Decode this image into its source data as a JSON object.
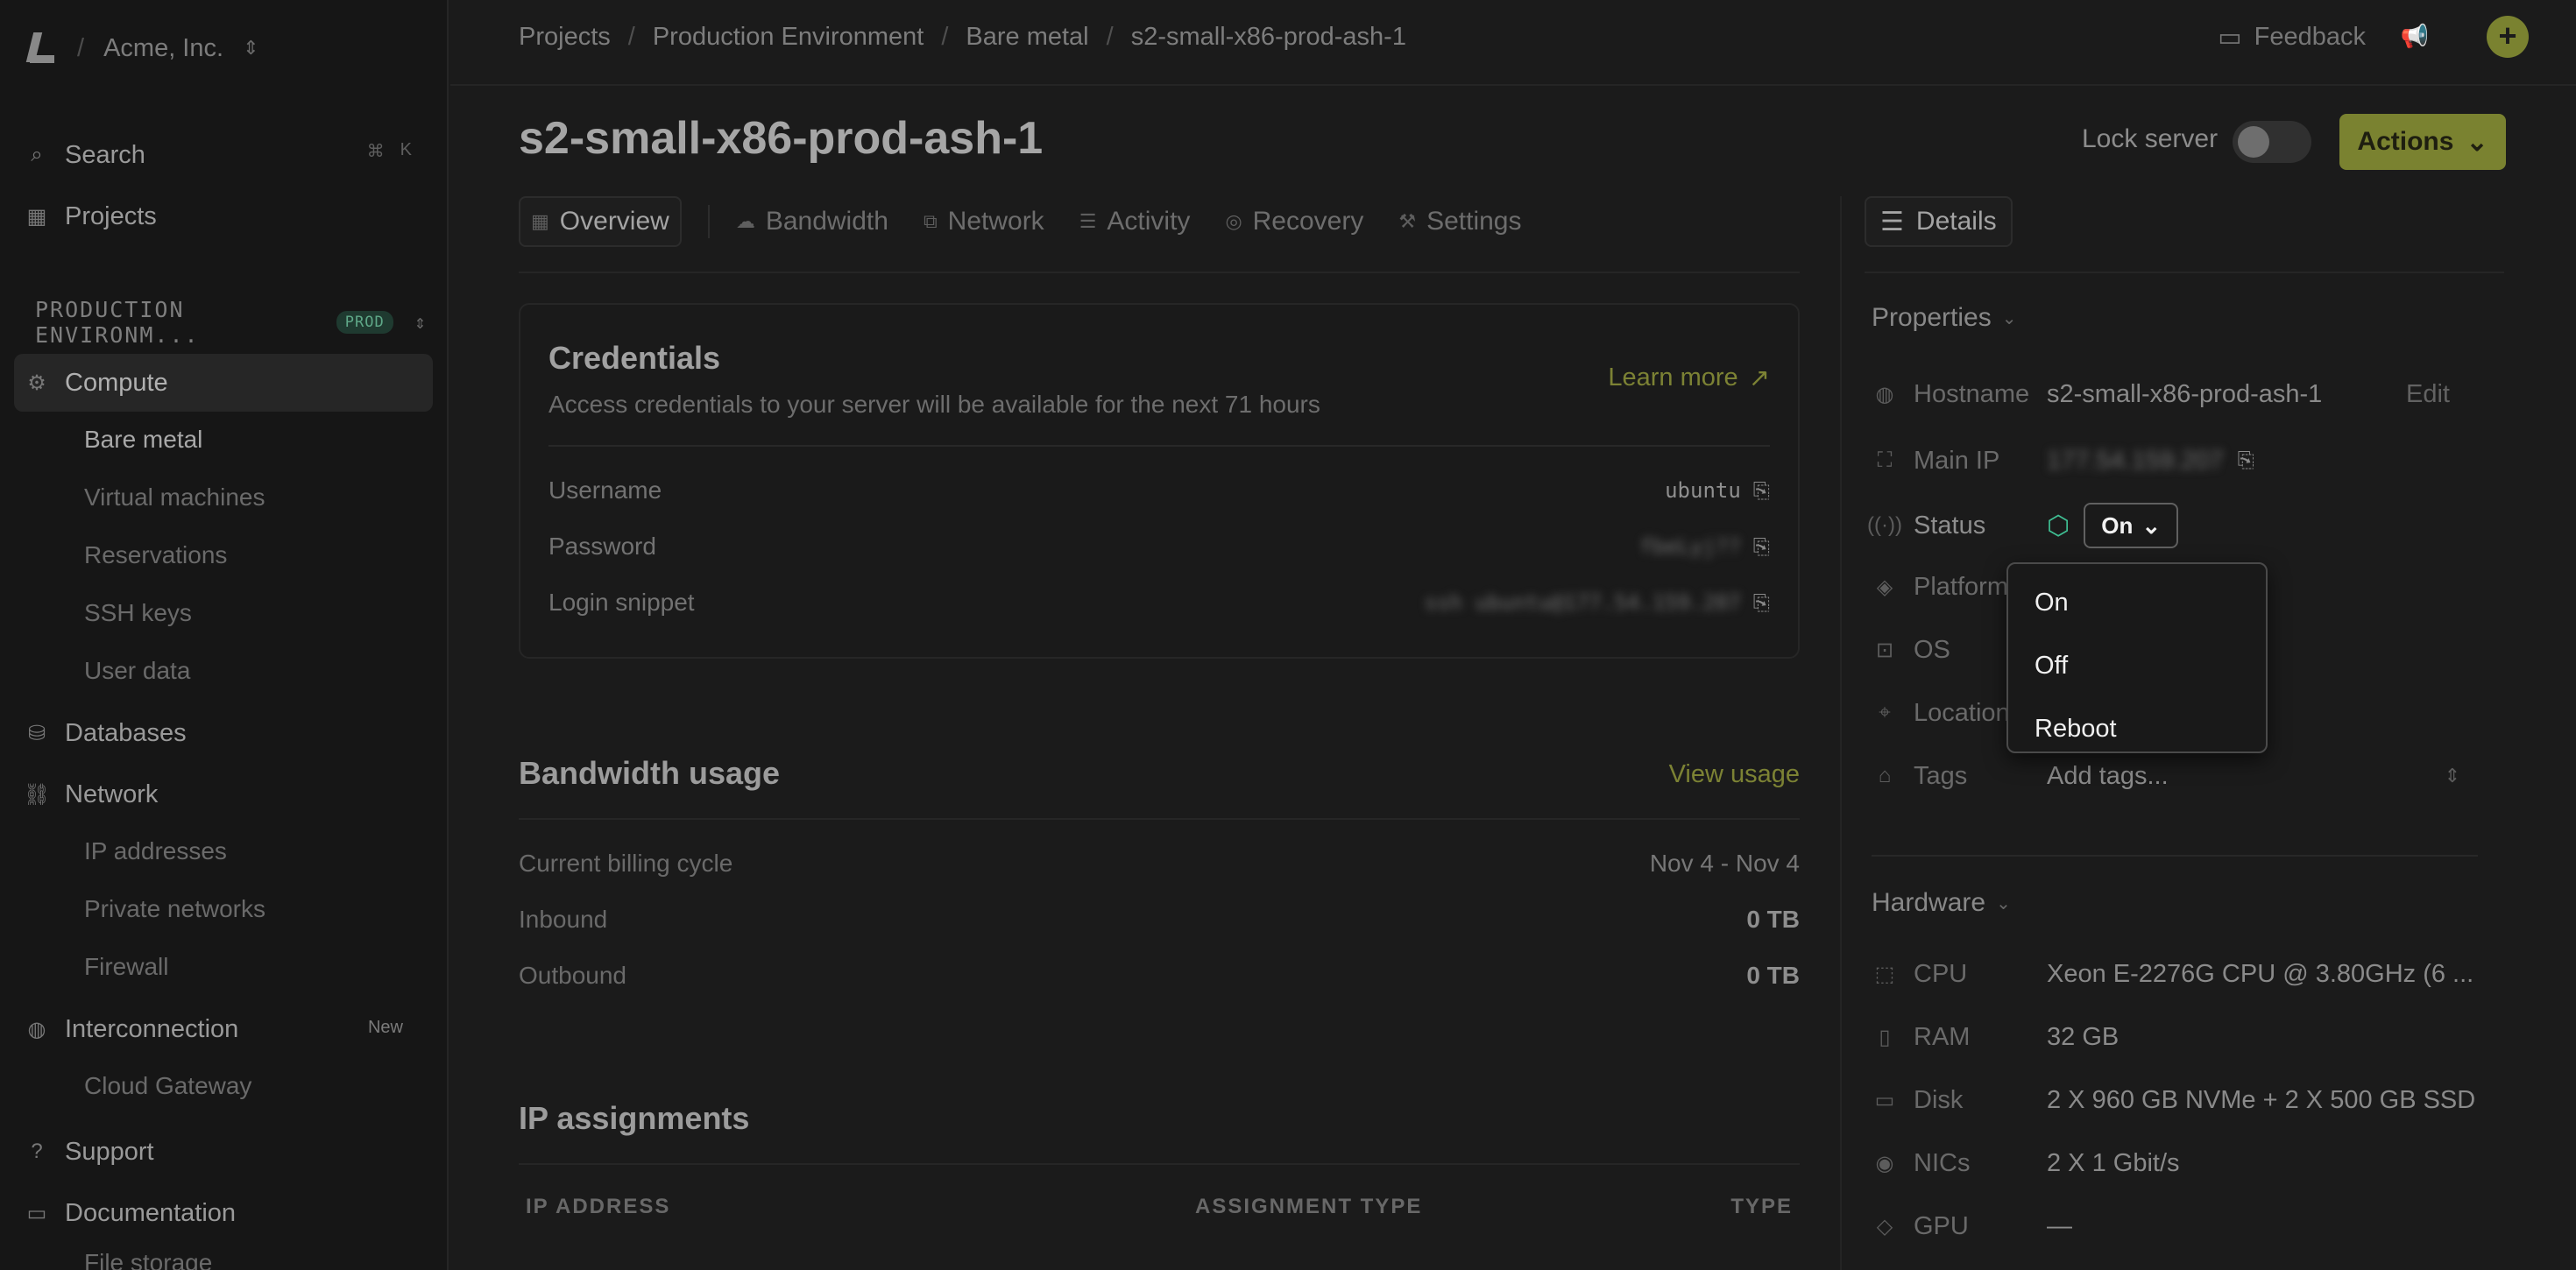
{
  "org": {
    "name": "Acme, Inc."
  },
  "sidebar": {
    "search_label": "Search",
    "shortcut": [
      "⌘",
      "K"
    ],
    "projects_label": "Projects",
    "env_name": "PRODUCTION ENVIRONM...",
    "env_badge": "PROD",
    "compute_label": "Compute",
    "compute_items": [
      "Bare metal",
      "Virtual machines",
      "Reservations",
      "SSH keys",
      "User data"
    ],
    "databases_label": "Databases",
    "network_label": "Network",
    "network_items": [
      "IP addresses",
      "Private networks",
      "Firewall"
    ],
    "interconnection_label": "Interconnection",
    "interconnection_badge": "New",
    "interconnection_items": [
      "Cloud Gateway"
    ],
    "support_label": "Support",
    "documentation_label": "Documentation",
    "file_storage_label": "File storage"
  },
  "breadcrumbs": [
    "Projects",
    "Production Environment",
    "Bare metal",
    "s2-small-x86-prod-ash-1"
  ],
  "topbar": {
    "feedback_label": "Feedback"
  },
  "server": {
    "title": "s2-small-x86-prod-ash-1",
    "lock_label": "Lock server",
    "lock_on": false,
    "actions_label": "Actions"
  },
  "tabs": [
    "Overview",
    "Bandwidth",
    "Network",
    "Activity",
    "Recovery",
    "Settings"
  ],
  "details_tab": "Details",
  "credentials": {
    "title": "Credentials",
    "subtitle": "Access credentials to your server will be available for the next 71 hours",
    "learn_more": "Learn more",
    "rows": [
      {
        "label": "Username",
        "value": "ubuntu"
      },
      {
        "label": "Password",
        "value": "fbeLyj??"
      },
      {
        "label": "Login snippet",
        "value": "ssh ubuntu@177.54.159.207"
      }
    ]
  },
  "bandwidth": {
    "title": "Bandwidth usage",
    "view_usage": "View usage",
    "rows": [
      {
        "label": "Current billing cycle",
        "value": "Nov 4 - Nov 4"
      },
      {
        "label": "Inbound",
        "value": "0 TB"
      },
      {
        "label": "Outbound",
        "value": "0 TB"
      }
    ]
  },
  "ip_assignments": {
    "title": "IP assignments",
    "columns": [
      "IP ADDRESS",
      "ASSIGNMENT TYPE",
      "TYPE"
    ]
  },
  "properties": {
    "title": "Properties",
    "hostname_label": "Hostname",
    "hostname": "s2-small-x86-prod-ash-1",
    "edit_label": "Edit",
    "main_ip_label": "Main IP",
    "main_ip": "177.54.159.207",
    "status_label": "Status",
    "status_value": "On",
    "status_color": "#3fbf93",
    "platform_label": "Platform",
    "os_label": "OS",
    "location_label": "Location",
    "tags_label": "Tags",
    "tags_placeholder": "Add tags..."
  },
  "status_dropdown": {
    "options": [
      "On",
      "Off",
      "Reboot"
    ]
  },
  "hardware": {
    "title": "Hardware",
    "rows": [
      {
        "label": "CPU",
        "value": "Xeon E-2276G CPU @ 3.80GHz (6 ..."
      },
      {
        "label": "RAM",
        "value": "32 GB"
      },
      {
        "label": "Disk",
        "value": "2 X 960 GB NVMe + 2 X 500 GB SSD"
      },
      {
        "label": "NICs",
        "value": "2 X 1 Gbit/s"
      },
      {
        "label": "GPU",
        "value": "—"
      }
    ]
  },
  "colors": {
    "accent": "#7a8230",
    "status_on": "#3fbf93",
    "background": "#1b1b1b"
  }
}
